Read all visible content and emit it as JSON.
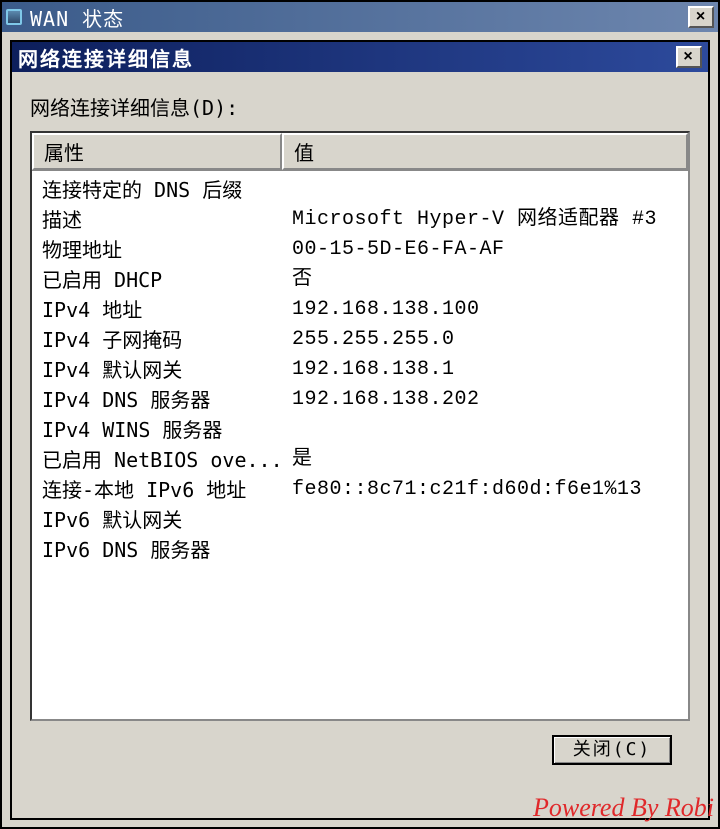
{
  "outer_window": {
    "title": "WAN 状态",
    "close_glyph": "×"
  },
  "inner_window": {
    "title": "网络连接详细信息",
    "close_glyph": "×"
  },
  "section_label": "网络连接详细信息(D):",
  "columns": {
    "col1": "属性",
    "col2": "值"
  },
  "rows": [
    {
      "prop": "连接特定的 DNS 后缀",
      "val": ""
    },
    {
      "prop": "描述",
      "val": "Microsoft Hyper-V 网络适配器 #3"
    },
    {
      "prop": "物理地址",
      "val": "00-15-5D-E6-FA-AF"
    },
    {
      "prop": "已启用 DHCP",
      "val": "否"
    },
    {
      "prop": "IPv4 地址",
      "val": "192.168.138.100"
    },
    {
      "prop": "IPv4 子网掩码",
      "val": "255.255.255.0"
    },
    {
      "prop": "IPv4 默认网关",
      "val": "192.168.138.1"
    },
    {
      "prop": "IPv4 DNS 服务器",
      "val": "192.168.138.202"
    },
    {
      "prop": "IPv4 WINS 服务器",
      "val": ""
    },
    {
      "prop": "已启用 NetBIOS ove...",
      "val": "是"
    },
    {
      "prop": "连接-本地 IPv6 地址",
      "val": "fe80::8c71:c21f:d60d:f6e1%13"
    },
    {
      "prop": "IPv6 默认网关",
      "val": ""
    },
    {
      "prop": "IPv6 DNS 服务器",
      "val": ""
    }
  ],
  "buttons": {
    "close": "关闭(C)"
  },
  "watermark": "Powered By Robi"
}
